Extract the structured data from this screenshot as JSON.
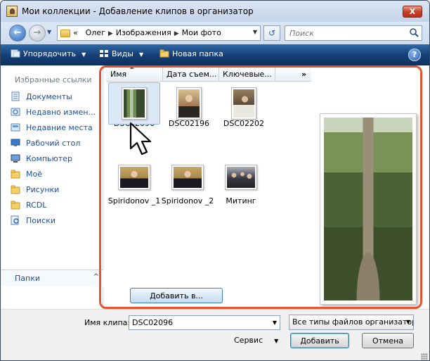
{
  "window": {
    "title": "Мои коллекции - Добавление клипов в организатор",
    "close_glyph": "X"
  },
  "address_bar": {
    "overflow_marker": "«",
    "breadcrumbs": [
      "Олег",
      "Изображения",
      "Мои фото"
    ],
    "search_placeholder": "Поиск"
  },
  "toolbar": {
    "organize": "Упорядочить",
    "views": "Виды",
    "new_folder": "Новая папка",
    "help_glyph": "?"
  },
  "nav_pane": {
    "favorites_title": "Избранные ссылки",
    "favorites": [
      {
        "label": "Документы",
        "icon": "documents-icon"
      },
      {
        "label": "Недавно измен...",
        "icon": "recently-changed-icon"
      },
      {
        "label": "Недавние места",
        "icon": "recent-places-icon"
      },
      {
        "label": "Рабочий стол",
        "icon": "desktop-icon"
      },
      {
        "label": "Компьютер",
        "icon": "computer-icon"
      },
      {
        "label": "Moë",
        "icon": "folder-icon"
      },
      {
        "label": "Рисунки",
        "icon": "folder-icon"
      },
      {
        "label": "RCDL",
        "icon": "folder-icon"
      },
      {
        "label": "Поиски",
        "icon": "searches-icon"
      }
    ],
    "folders_label": "Папки",
    "folders_chevron": "^"
  },
  "file_list": {
    "columns": [
      "Имя",
      "Дата съем...",
      "Ключевые..."
    ],
    "more_columns": "»",
    "files": [
      {
        "name": "DSC02096",
        "selected": true
      },
      {
        "name": "DSC02196",
        "selected": false
      },
      {
        "name": "DSC02202",
        "selected": false
      },
      {
        "name": "Spiridonov _1",
        "selected": false
      },
      {
        "name": "Spiridonov _2",
        "selected": false
      },
      {
        "name": "Митинг",
        "selected": false
      }
    ],
    "add_to_button": "Добавить в..."
  },
  "bottom_bar": {
    "clip_name_label": "Имя клипа:",
    "clip_name_value": "DSC02096",
    "file_type": "Все типы файлов организатор",
    "service": "Сервис",
    "add_button": "Добавить",
    "cancel_button": "Отмена"
  },
  "colors": {
    "toolbar": "#163f76",
    "highlight": "#e2552e",
    "link": "#1a4fa0"
  }
}
